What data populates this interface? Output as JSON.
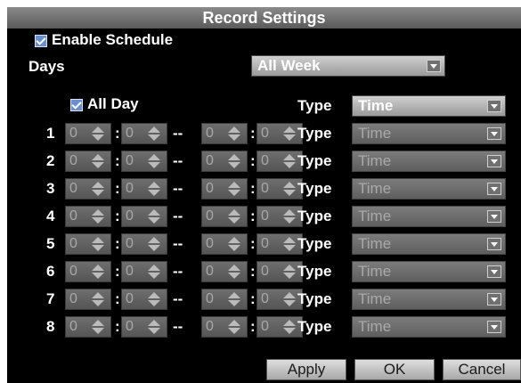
{
  "window": {
    "title": "Record Settings"
  },
  "schedule": {
    "enable_label": "Enable Schedule",
    "enabled": true
  },
  "days": {
    "label": "Days",
    "selected": "All Week"
  },
  "all_day": {
    "label": "All Day",
    "checked": true,
    "type_label": "Type",
    "type_value": "Time"
  },
  "periods": [
    {
      "index": "1",
      "start_h": "0",
      "start_m": "0",
      "end_h": "0",
      "end_m": "0",
      "type_label": "Type",
      "type_value": "Time"
    },
    {
      "index": "2",
      "start_h": "0",
      "start_m": "0",
      "end_h": "0",
      "end_m": "0",
      "type_label": "Type",
      "type_value": "Time"
    },
    {
      "index": "3",
      "start_h": "0",
      "start_m": "0",
      "end_h": "0",
      "end_m": "0",
      "type_label": "Type",
      "type_value": "Time"
    },
    {
      "index": "4",
      "start_h": "0",
      "start_m": "0",
      "end_h": "0",
      "end_m": "0",
      "type_label": "Type",
      "type_value": "Time"
    },
    {
      "index": "5",
      "start_h": "0",
      "start_m": "0",
      "end_h": "0",
      "end_m": "0",
      "type_label": "Type",
      "type_value": "Time"
    },
    {
      "index": "6",
      "start_h": "0",
      "start_m": "0",
      "end_h": "0",
      "end_m": "0",
      "type_label": "Type",
      "type_value": "Time"
    },
    {
      "index": "7",
      "start_h": "0",
      "start_m": "0",
      "end_h": "0",
      "end_m": "0",
      "type_label": "Type",
      "type_value": "Time"
    },
    {
      "index": "8",
      "start_h": "0",
      "start_m": "0",
      "end_h": "0",
      "end_m": "0",
      "type_label": "Type",
      "type_value": "Time"
    }
  ],
  "separators": {
    "time": ":",
    "range": "--"
  },
  "buttons": {
    "apply": "Apply",
    "ok": "OK",
    "cancel": "Cancel"
  },
  "colors": {
    "background": "#000000",
    "checkbox": "#6a8fd0",
    "text": "#ffffff",
    "disabled_text": "#a9a9a9"
  }
}
